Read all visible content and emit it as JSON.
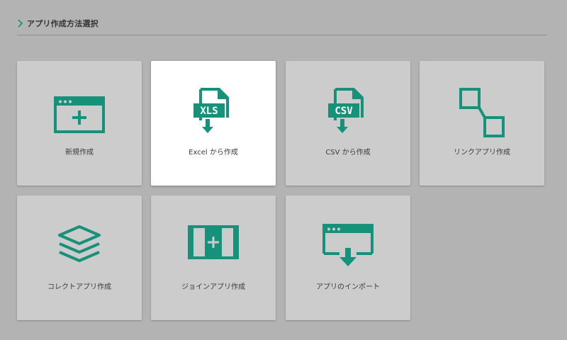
{
  "header": {
    "title": "アプリ作成方法選択",
    "chevron_icon": "chevron-right-icon"
  },
  "colors": {
    "accent": "#16917a",
    "page_bg": "#b3b3b3",
    "tile_bg": "#cccccc",
    "tile_selected_bg": "#ffffff",
    "label_text": "#3a3a3a"
  },
  "options": [
    {
      "label": "新規作成",
      "icon": "new-window-icon",
      "selected": false
    },
    {
      "label": "Excel から作成",
      "icon": "xls-file-icon",
      "icon_text": "XLS",
      "selected": true
    },
    {
      "label": "CSV から作成",
      "icon": "csv-file-icon",
      "icon_text": "CSV",
      "selected": false
    },
    {
      "label": "リンクアプリ作成",
      "icon": "link-squares-icon",
      "selected": false
    },
    {
      "label": "コレクトアプリ作成",
      "icon": "layers-icon",
      "selected": false
    },
    {
      "label": "ジョインアプリ作成",
      "icon": "join-panels-icon",
      "selected": false
    },
    {
      "label": "アプリのインポート",
      "icon": "import-window-icon",
      "selected": false
    }
  ]
}
